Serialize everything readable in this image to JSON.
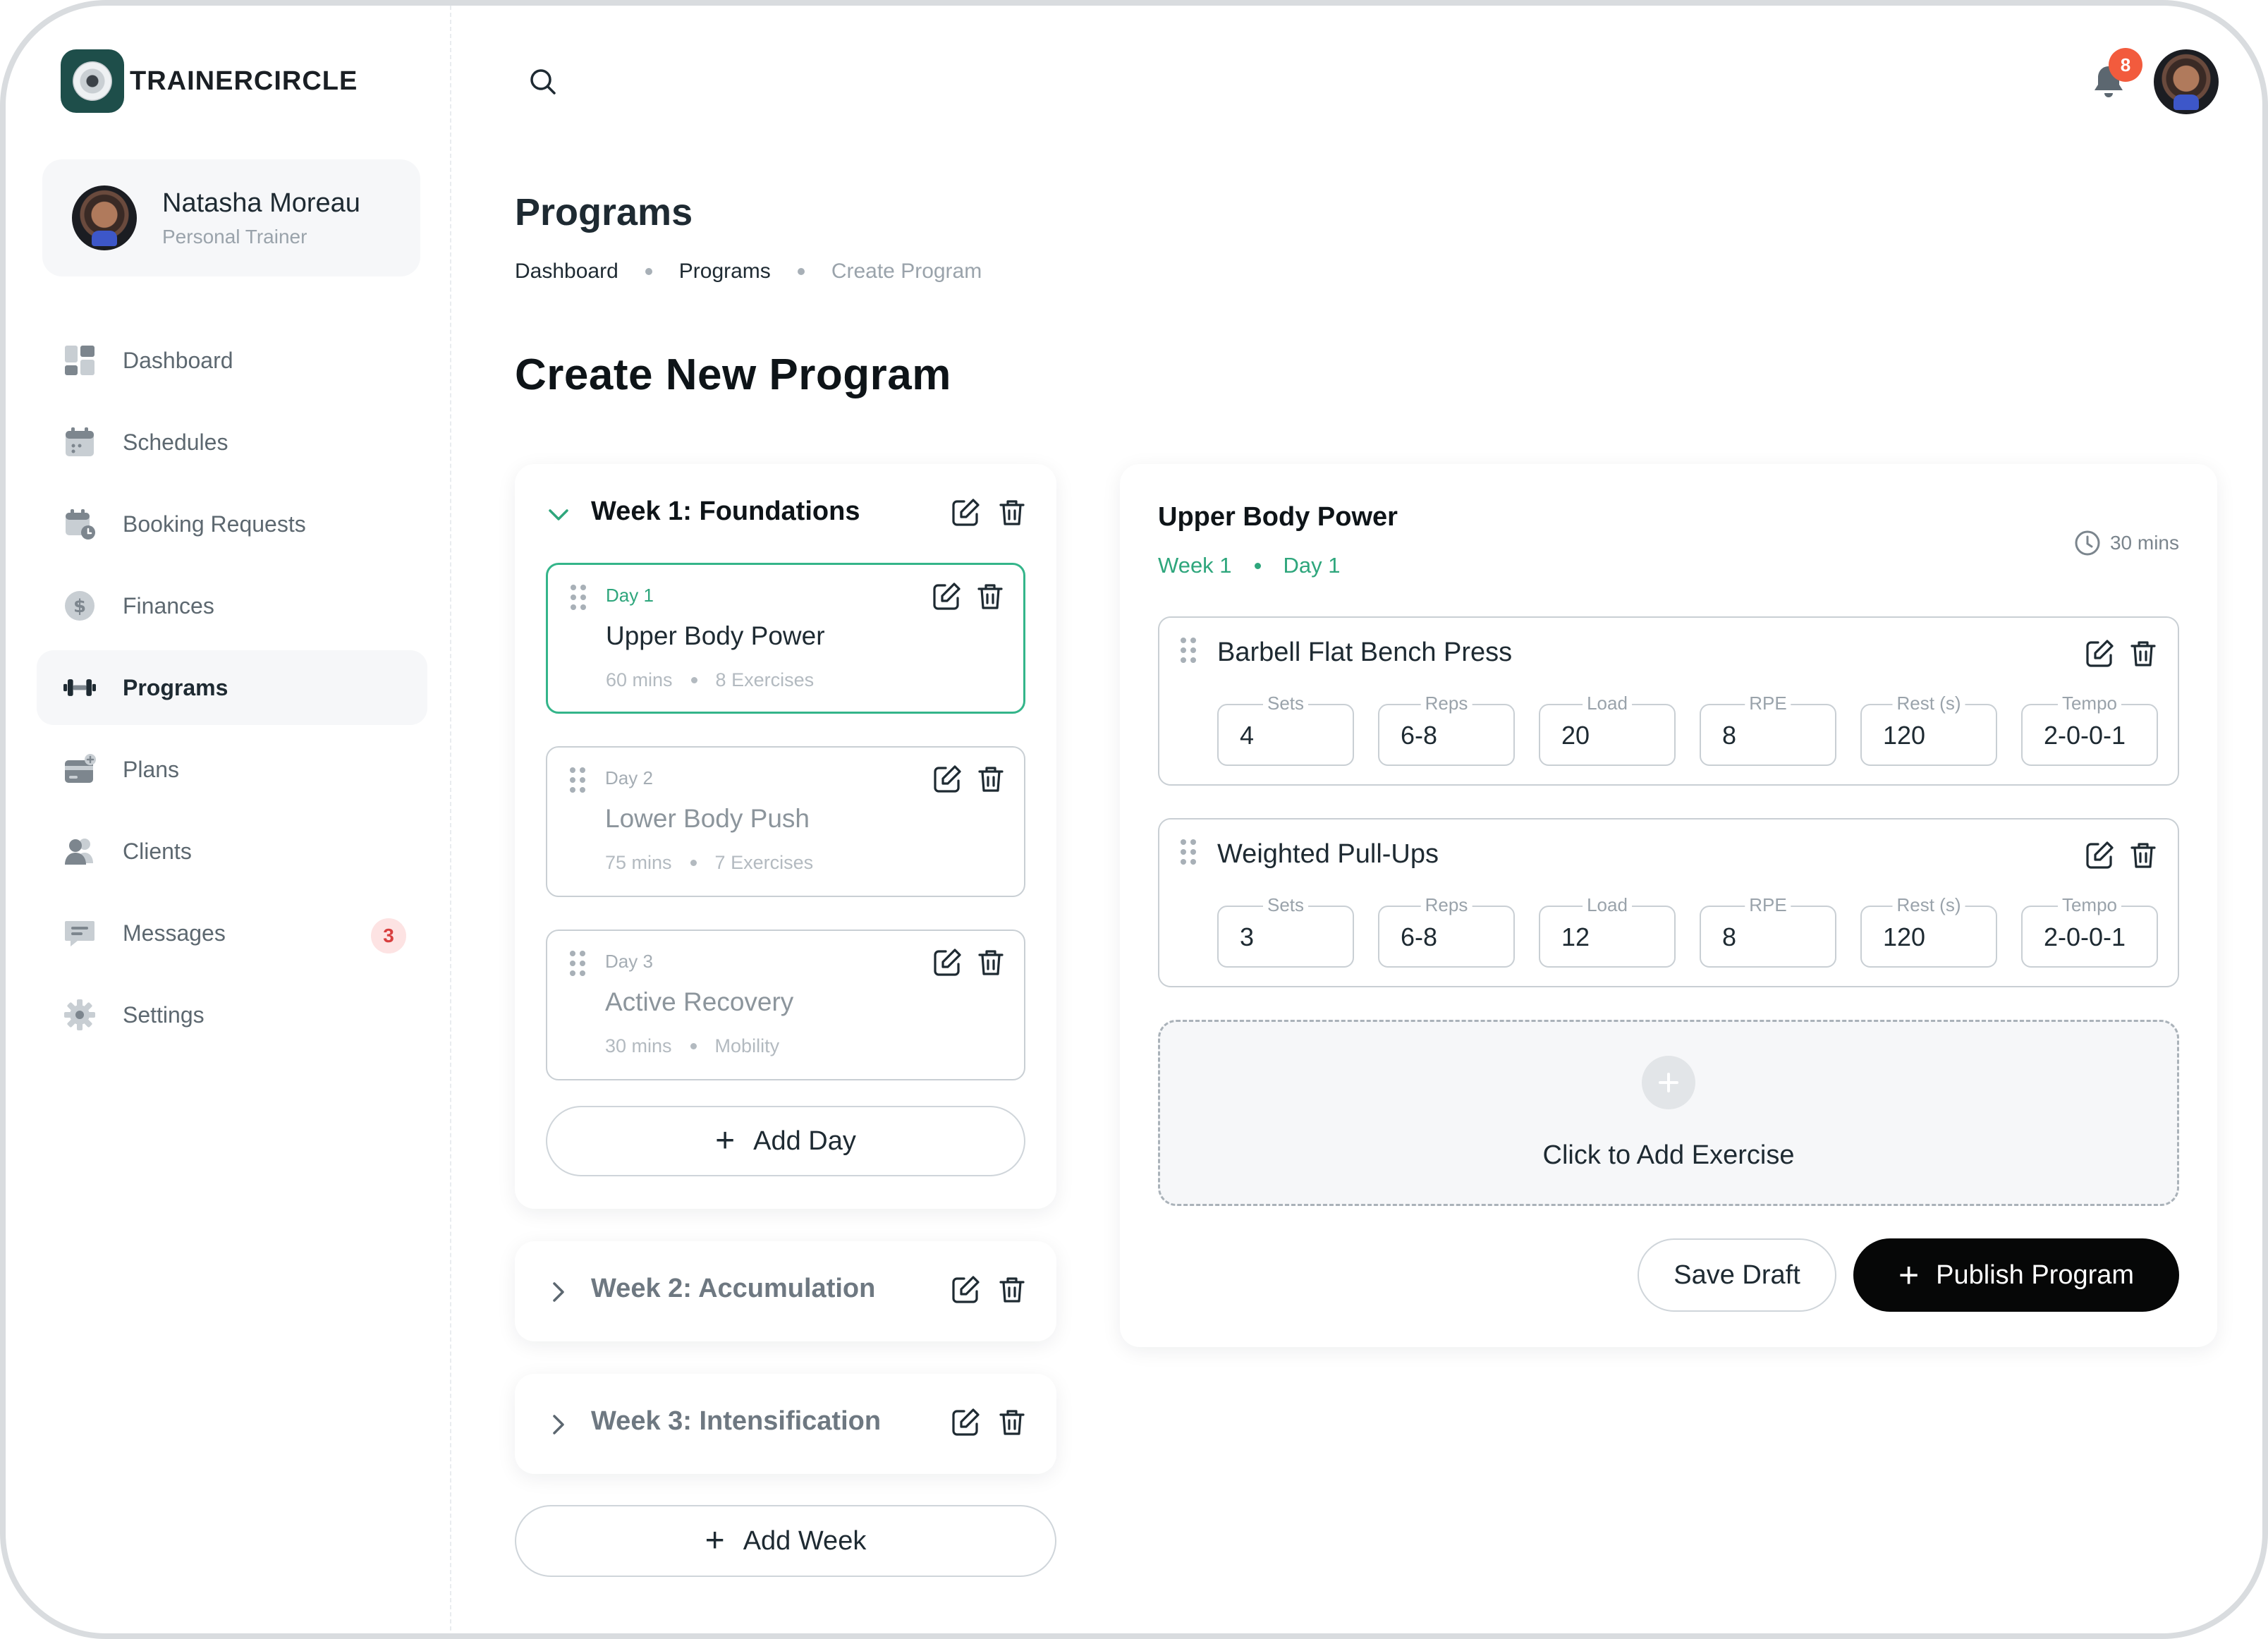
{
  "brand": {
    "name": "TRAINERCIRCLE"
  },
  "profile": {
    "name": "Natasha Moreau",
    "role": "Personal Trainer"
  },
  "nav": [
    {
      "label": "Dashboard",
      "icon": "dashboard-icon"
    },
    {
      "label": "Schedules",
      "icon": "calendar-icon"
    },
    {
      "label": "Booking Requests",
      "icon": "calendar-clock-icon"
    },
    {
      "label": "Finances",
      "icon": "dollar-icon"
    },
    {
      "label": "Programs",
      "icon": "dumbbell-icon",
      "active": true
    },
    {
      "label": "Plans",
      "icon": "card-icon"
    },
    {
      "label": "Clients",
      "icon": "users-icon"
    },
    {
      "label": "Messages",
      "icon": "message-icon",
      "badge": "3"
    },
    {
      "label": "Settings",
      "icon": "gear-icon"
    }
  ],
  "topbar": {
    "notifications": "8"
  },
  "header": {
    "title": "Programs",
    "breadcrumb": [
      "Dashboard",
      "Programs",
      "Create Program"
    ],
    "section_title": "Create New Program"
  },
  "weeks": [
    {
      "title": "Week 1: Foundations",
      "expanded": true,
      "days": [
        {
          "label": "Day 1",
          "name": "Upper Body Power",
          "duration": "60 mins",
          "detail": "8 Exercises",
          "selected": true
        },
        {
          "label": "Day 2",
          "name": "Lower Body Push",
          "duration": "75 mins",
          "detail": "7 Exercises"
        },
        {
          "label": "Day 3",
          "name": "Active Recovery",
          "duration": "30 mins",
          "detail": "Mobility"
        }
      ],
      "add_day_label": "Add Day"
    },
    {
      "title": "Week 2: Accumulation",
      "expanded": false
    },
    {
      "title": "Week 3: Intensification",
      "expanded": false
    }
  ],
  "add_week_label": "Add Week",
  "panel": {
    "title": "Upper Body Power",
    "week": "Week 1",
    "day": "Day 1",
    "duration": "30 mins",
    "field_labels": [
      "Sets",
      "Reps",
      "Load",
      "RPE",
      "Rest (s)",
      "Tempo"
    ],
    "exercises": [
      {
        "name": "Barbell Flat Bench Press",
        "values": [
          "4",
          "6-8",
          "20",
          "8",
          "120",
          "2-0-0-1"
        ]
      },
      {
        "name": "Weighted Pull-Ups",
        "values": [
          "3",
          "6-8",
          "12",
          "8",
          "120",
          "2-0-0-1"
        ]
      }
    ],
    "add_exercise_label": "Click to Add Exercise",
    "save_draft_label": "Save Draft",
    "publish_label": "Publish Program"
  },
  "colors": {
    "accent": "#2ea67c",
    "brand": "#1e4e4a",
    "badge": "#f25b3d",
    "primary_button": "#060707"
  }
}
